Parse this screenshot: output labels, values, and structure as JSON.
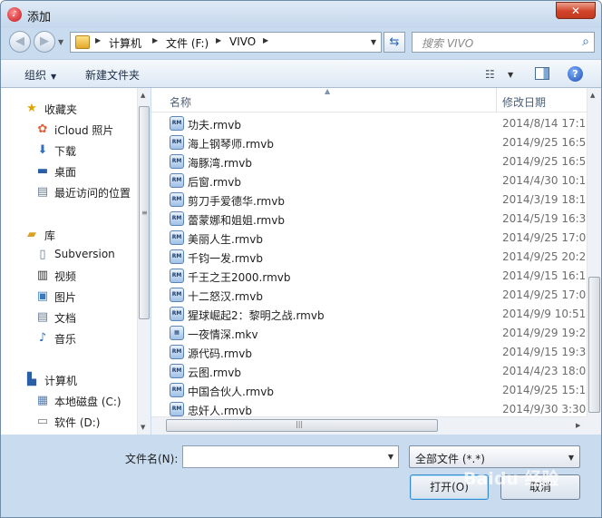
{
  "window": {
    "title": "添加",
    "app_icon_glyph": "♪"
  },
  "nav": {
    "back_glyph": "◀",
    "forward_glyph": "▶"
  },
  "address": {
    "crumbs": [
      "计算机",
      "文件 (F:)",
      "VIVO"
    ],
    "separator_glyph": "▶"
  },
  "search": {
    "placeholder": "搜索 VIVO"
  },
  "toolbar": {
    "organize": "组织",
    "new_folder": "新建文件夹"
  },
  "navpane": {
    "favorites": {
      "label": "收藏夹",
      "items": [
        "iCloud 照片",
        "下载",
        "桌面",
        "最近访问的位置"
      ]
    },
    "libraries": {
      "label": "库",
      "items": [
        "Subversion",
        "视频",
        "图片",
        "文档",
        "音乐"
      ]
    },
    "computer": {
      "label": "计算机",
      "items": [
        "本地磁盘 (C:)",
        "软件 (D:)"
      ]
    }
  },
  "filelist": {
    "columns": {
      "name": "名称",
      "date": "修改日期"
    },
    "rows": [
      {
        "name": "功夫.rmvb",
        "date": "2014/8/14 17:1",
        "icon": "RM"
      },
      {
        "name": "海上钢琴师.rmvb",
        "date": "2014/9/25 16:5",
        "icon": "RM"
      },
      {
        "name": "海豚湾.rmvb",
        "date": "2014/9/25 16:5",
        "icon": "RM"
      },
      {
        "name": "后窗.rmvb",
        "date": "2014/4/30 10:1",
        "icon": "RM"
      },
      {
        "name": "剪刀手爱德华.rmvb",
        "date": "2014/3/19 18:1",
        "icon": "RM"
      },
      {
        "name": "蕾蒙娜和姐姐.rmvb",
        "date": "2014/5/19 16:3",
        "icon": "RM"
      },
      {
        "name": "美丽人生.rmvb",
        "date": "2014/9/25 17:0",
        "icon": "RM"
      },
      {
        "name": "千钧一发.rmvb",
        "date": "2014/9/25 20:2",
        "icon": "RM"
      },
      {
        "name": "千王之王2000.rmvb",
        "date": "2014/9/15 16:1",
        "icon": "RM"
      },
      {
        "name": "十二怒汉.rmvb",
        "date": "2014/9/25 17:0",
        "icon": "RM"
      },
      {
        "name": "猩球崛起2：黎明之战.rmvb",
        "date": "2014/9/9 10:51",
        "icon": "RM"
      },
      {
        "name": "一夜情深.mkv",
        "date": "2014/9/29 19:2",
        "icon": "▦"
      },
      {
        "name": "源代码.rmvb",
        "date": "2014/9/15 19:3",
        "icon": "RM"
      },
      {
        "name": "云图.rmvb",
        "date": "2014/4/23 18:0",
        "icon": "RM"
      },
      {
        "name": "中国合伙人.rmvb",
        "date": "2014/9/25 15:1",
        "icon": "RM"
      },
      {
        "name": "忠奸人.rmvb",
        "date": "2014/9/30 3:30",
        "icon": "RM"
      }
    ]
  },
  "bottom": {
    "filename_label": "文件名(N):",
    "filename_value": "",
    "filetype_value": "全部文件 (*.*)",
    "open_label": "打开(O)",
    "cancel_label": "取消"
  },
  "watermark": "Baidu 经验",
  "colors": {
    "accent": "#3b89c9",
    "titlebar": "#c4d7ec",
    "close": "#d2442a"
  }
}
